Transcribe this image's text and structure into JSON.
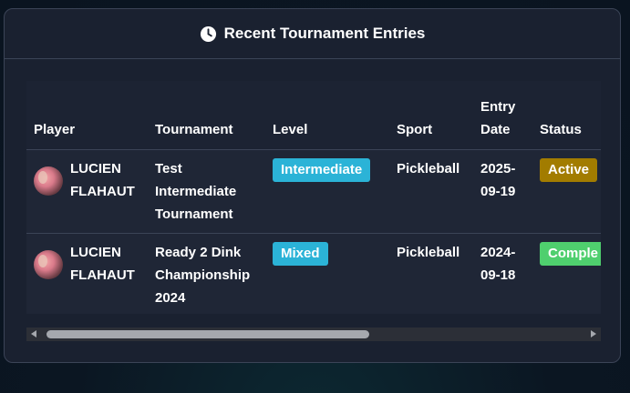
{
  "card": {
    "title": "Recent Tournament Entries",
    "icon": "clock-icon"
  },
  "table": {
    "headers": [
      "Player",
      "Tournament",
      "Level",
      "Sport",
      "Entry Date",
      "Status"
    ],
    "rows": [
      {
        "player": "LUCIEN FLAHAUT",
        "tournament": "Test Intermediate Tournament",
        "level": "Intermediate",
        "sport": "Pickleball",
        "entry_date": "2025-09-19",
        "status": "Active"
      },
      {
        "player": "LUCIEN FLAHAUT",
        "tournament": "Ready 2 Dink Championship 2024",
        "level": "Mixed",
        "sport": "Pickleball",
        "entry_date": "2024-09-18",
        "status": "Comple"
      }
    ]
  },
  "colors": {
    "level_badge": "#2bb3d7",
    "status_active": "#a27c00",
    "status_completed": "#4fcf6e"
  },
  "scrollbar": {
    "position": 0
  }
}
